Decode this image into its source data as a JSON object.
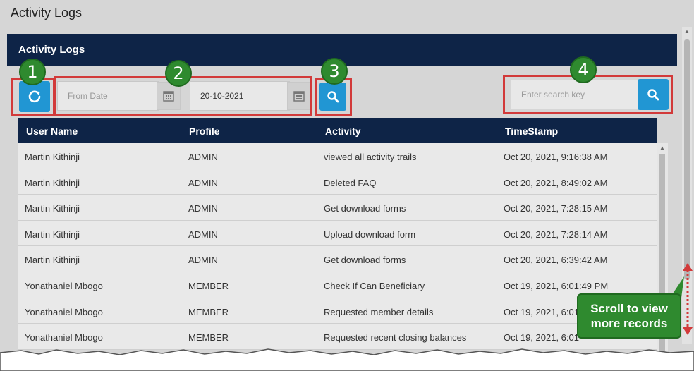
{
  "page": {
    "title": "Activity Logs"
  },
  "panel": {
    "title": "Activity Logs"
  },
  "filters": {
    "from_placeholder": "From Date",
    "to_value": "20-10-2021",
    "search_placeholder": "Enter search key"
  },
  "badges": [
    "1",
    "2",
    "3",
    "4"
  ],
  "table": {
    "headers": [
      "User Name",
      "Profile",
      "Activity",
      "TimeStamp"
    ],
    "rows": [
      [
        "Martin Kithinji",
        "ADMIN",
        "viewed all activity trails",
        "Oct 20, 2021, 9:16:38 AM"
      ],
      [
        "Martin Kithinji",
        "ADMIN",
        "Deleted FAQ",
        "Oct 20, 2021, 8:49:02 AM"
      ],
      [
        "Martin Kithinji",
        "ADMIN",
        "Get download forms",
        "Oct 20, 2021, 7:28:15 AM"
      ],
      [
        "Martin Kithinji",
        "ADMIN",
        "Upload download form",
        "Oct 20, 2021, 7:28:14 AM"
      ],
      [
        "Martin Kithinji",
        "ADMIN",
        "Get download forms",
        "Oct 20, 2021, 6:39:42 AM"
      ],
      [
        "Yonathaniel Mbogo",
        "MEMBER",
        "Check If Can Beneficiary",
        "Oct 19, 2021, 6:01:49 PM"
      ],
      [
        "Yonathaniel Mbogo",
        "MEMBER",
        "Requested member details",
        "Oct 19, 2021, 6:01"
      ],
      [
        "Yonathaniel Mbogo",
        "MEMBER",
        "Requested recent closing balances",
        "Oct 19, 2021, 6:01"
      ]
    ]
  },
  "callout": {
    "line1": "Scroll to view",
    "line2": "more records"
  },
  "colors": {
    "header": "#0e2447",
    "accent": "#2196d3",
    "annotation": "#d23a3a",
    "badge": "#2f8a2f"
  }
}
